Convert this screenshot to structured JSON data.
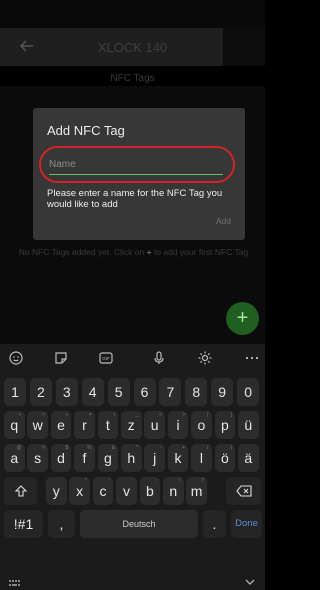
{
  "app_bar": {
    "title": "XLOCK 140"
  },
  "subtitle": "NFC Tags",
  "dialog": {
    "title": "Add NFC Tag",
    "name_placeholder": "Name",
    "helper_text": "Please enter a name for the NFC Tag you would like to add",
    "add_label": "Add"
  },
  "empty_state": {
    "text_before": "No NFC Tags added yet. Click on ",
    "plus": "+",
    "text_after": " to add your first NFC Tag"
  },
  "fab_label": "+",
  "keyboard": {
    "toolbar_icons": [
      "emoji-icon",
      "sticker-icon",
      "gif-icon",
      "microphone-icon",
      "settings-icon",
      "more-icon"
    ],
    "gif_label": "GIF",
    "number_row": [
      "1",
      "2",
      "3",
      "4",
      "5",
      "6",
      "7",
      "8",
      "9",
      "0"
    ],
    "row1": [
      "q",
      "w",
      "e",
      "r",
      "t",
      "z",
      "u",
      "i",
      "o",
      "p",
      "ü"
    ],
    "row1_hints": [
      "+",
      "×",
      "÷",
      "=",
      "/",
      "_",
      "<",
      ">",
      "[",
      "]",
      ""
    ],
    "row2": [
      "a",
      "s",
      "d",
      "f",
      "g",
      "h",
      "j",
      "k",
      "l",
      "ö",
      "ä"
    ],
    "row2_hints": [
      "@",
      "#",
      "$",
      "%",
      "&",
      "*",
      "-",
      "+",
      "(",
      ")",
      ""
    ],
    "row3": [
      "y",
      "x",
      "c",
      "v",
      "b",
      "n",
      "m"
    ],
    "row3_hints": [
      "",
      "\"",
      "'",
      ":",
      ";",
      "!",
      "?"
    ],
    "symbols_label": "!#1",
    "comma_label": ",",
    "space_label": "Deutsch",
    "period_label": ".",
    "done_label": "Done"
  }
}
